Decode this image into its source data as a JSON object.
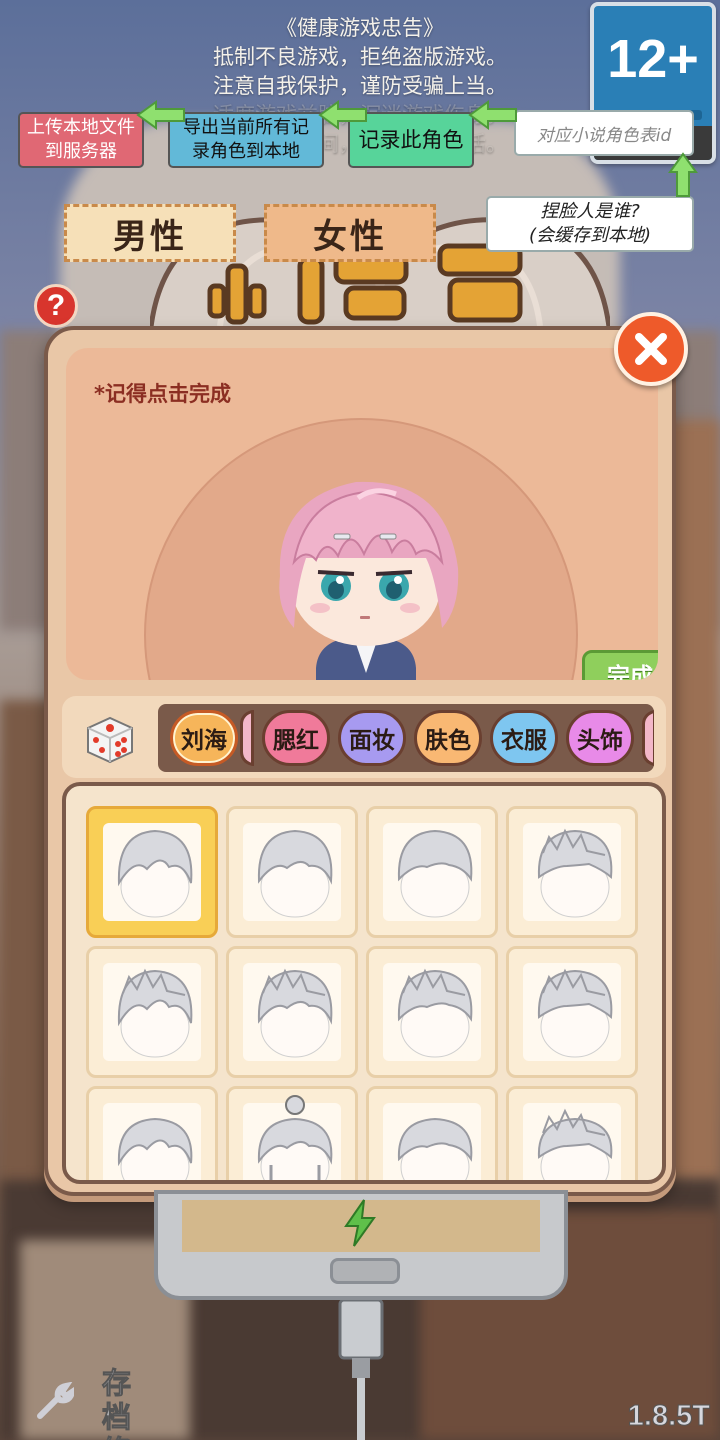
{
  "notice": {
    "lines": [
      "《健康游戏忠告》",
      "抵制不良游戏，拒绝盗版游戏。",
      "注意自我保护，谨防受骗上当。",
      "适度游戏益脑，沉迷游戏伤身。",
      "合理安排时间，享受健康生活。"
    ]
  },
  "age_rating": "12+",
  "dev_tools": {
    "upload": "上传本地文件\n到服务器",
    "export": "导出当前所有记\n录角色到本地",
    "record": "记录此角色",
    "novel_id_placeholder": "对应小说角色表id",
    "who": "捏脸人是谁?\n(会缓存到本地)"
  },
  "gender": {
    "male": "男性",
    "female": "女性"
  },
  "help": "?",
  "editor": {
    "reminder": "*记得点击完成",
    "done": "完成",
    "tabs": [
      {
        "label": "刘海",
        "color": "#f6b55a",
        "active": true
      },
      {
        "label": "腮红",
        "color": "#f07a9a",
        "active": false
      },
      {
        "label": "面妆",
        "color": "#a79af0",
        "active": false
      },
      {
        "label": "肤色",
        "color": "#f9b873",
        "active": false
      },
      {
        "label": "衣服",
        "color": "#7ec6f0",
        "active": false
      },
      {
        "label": "头饰",
        "color": "#e88ae8",
        "active": false
      }
    ],
    "hair_options_visible": 12,
    "selected_index": 0
  },
  "footer": {
    "repair": "存档\n修复",
    "version": "1.8.5T"
  }
}
